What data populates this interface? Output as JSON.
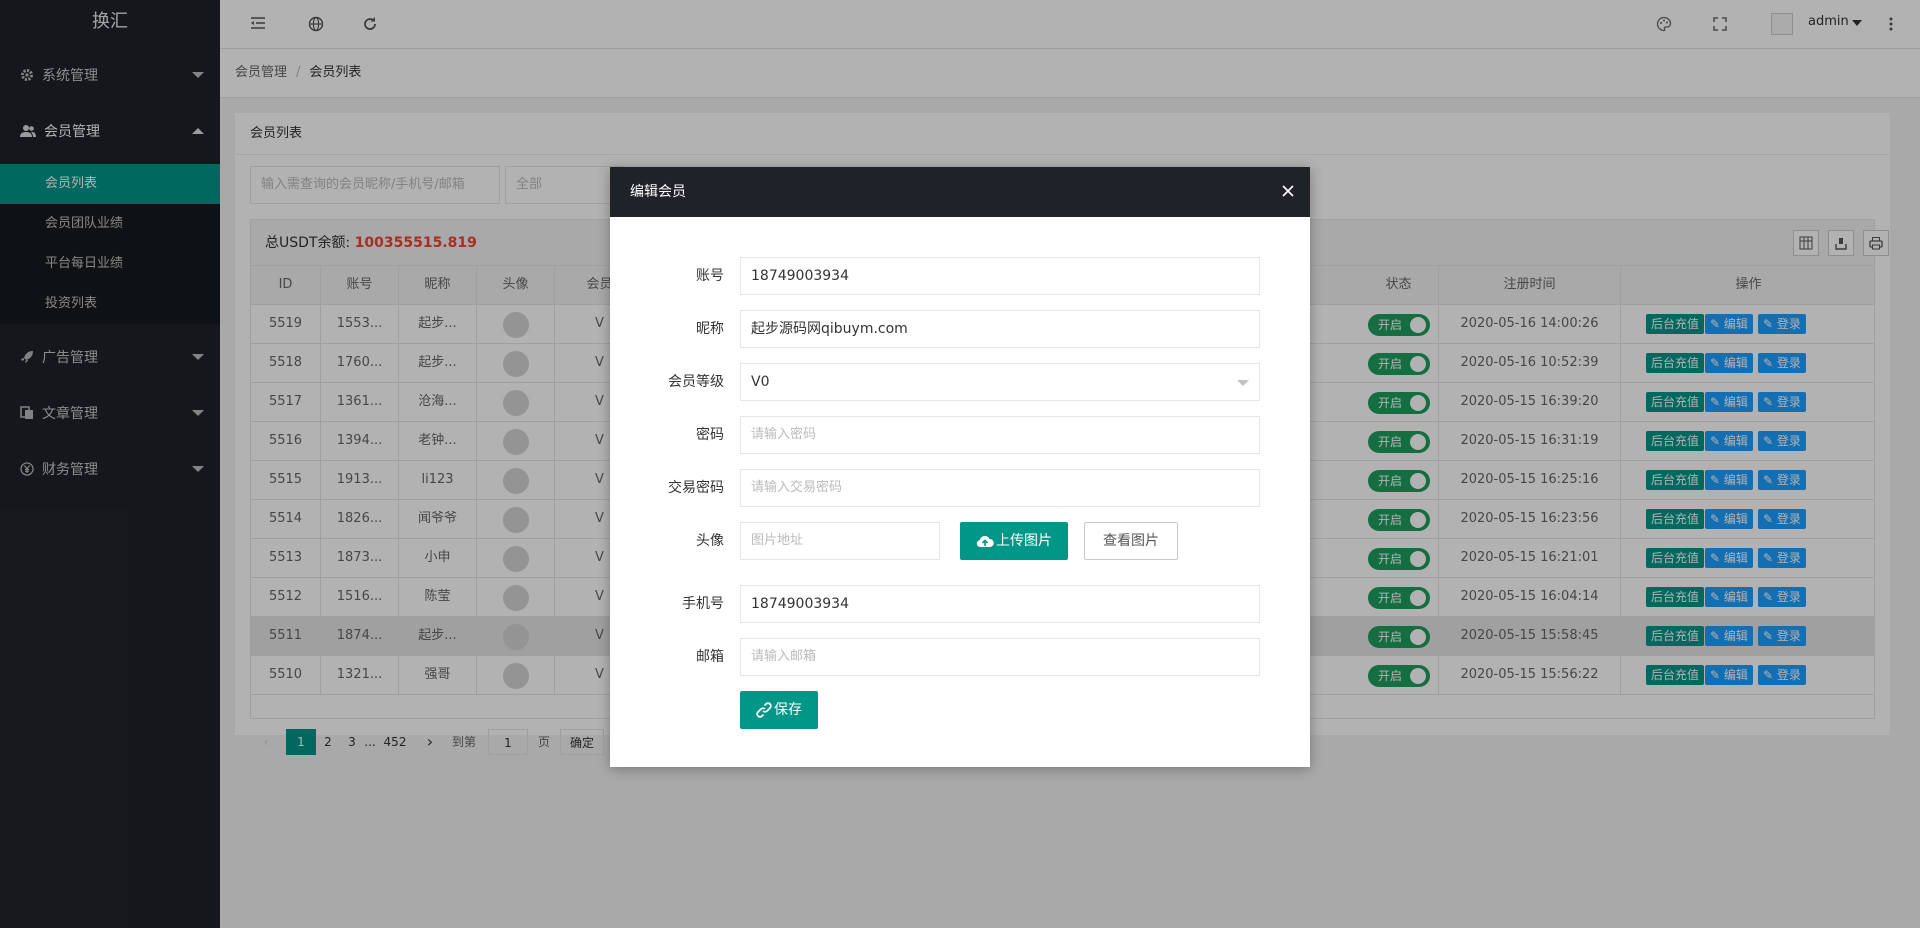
{
  "app": {
    "logo": "换汇",
    "user": "admin"
  },
  "sidebar": {
    "groups": [
      {
        "label": "系统管理",
        "icon": "gear-icon"
      },
      {
        "label": "会员管理",
        "icon": "users-icon",
        "expanded": true,
        "items": [
          "会员列表",
          "会员团队业绩",
          "平台每日业绩",
          "投资列表"
        ]
      },
      {
        "label": "广告管理",
        "icon": "rocket-icon"
      },
      {
        "label": "文章管理",
        "icon": "copy-icon"
      },
      {
        "label": "财务管理",
        "icon": "yen-icon"
      }
    ],
    "active_item": "会员列表"
  },
  "breadcrumb": {
    "parent": "会员管理",
    "separator": "/",
    "current": "会员列表"
  },
  "panel": {
    "title": "会员列表",
    "search_placeholder": "输入需查询的会员昵称/手机号/邮箱",
    "filter_value": "全部",
    "balance_label": "总USDT余额:",
    "balance_value": "100355515.819"
  },
  "table": {
    "columns": [
      "ID",
      "账号",
      "昵称",
      "头像",
      "会员",
      "状态",
      "注册时间",
      "操作"
    ],
    "switch_label": "开启",
    "actions": {
      "recharge": "后台充值",
      "edit": "编辑",
      "login": "登录"
    },
    "rows": [
      {
        "id": "5519",
        "account": "1553...",
        "nick": "起步...",
        "level": "V",
        "time": "2020-05-16 14:00:26"
      },
      {
        "id": "5518",
        "account": "1760...",
        "nick": "起步...",
        "level": "V",
        "time": "2020-05-16 10:52:39"
      },
      {
        "id": "5517",
        "account": "1361...",
        "nick": "沧海...",
        "level": "V",
        "time": "2020-05-15 16:39:20"
      },
      {
        "id": "5516",
        "account": "1394...",
        "nick": "老钟...",
        "level": "V",
        "time": "2020-05-15 16:31:19"
      },
      {
        "id": "5515",
        "account": "1913...",
        "nick": "li123",
        "level": "V",
        "time": "2020-05-15 16:25:16"
      },
      {
        "id": "5514",
        "account": "1826...",
        "nick": "闻爷爷",
        "level": "V",
        "time": "2020-05-15 16:23:56"
      },
      {
        "id": "5513",
        "account": "1873...",
        "nick": "小申",
        "level": "V",
        "time": "2020-05-15 16:21:01"
      },
      {
        "id": "5512",
        "account": "1516...",
        "nick": "陈莹",
        "level": "V",
        "time": "2020-05-15 16:04:14"
      },
      {
        "id": "5511",
        "account": "1874...",
        "nick": "起步...",
        "level": "V",
        "time": "2020-05-15 15:58:45"
      },
      {
        "id": "5510",
        "account": "1321...",
        "nick": "强哥",
        "level": "V",
        "time": "2020-05-15 15:56:22"
      }
    ]
  },
  "pager": {
    "pages": [
      "1",
      "2",
      "3",
      "...",
      "452"
    ],
    "goto_label": "到第",
    "goto_value": "1",
    "page_unit": "页",
    "confirm": "确定"
  },
  "modal": {
    "title": "编辑会员",
    "fields": {
      "account": {
        "label": "账号",
        "value": "18749003934"
      },
      "nickname": {
        "label": "昵称",
        "value": "起步源码网qibuym.com"
      },
      "level": {
        "label": "会员等级",
        "value": "V0"
      },
      "password": {
        "label": "密码",
        "placeholder": "请输入密码"
      },
      "trade_password": {
        "label": "交易密码",
        "placeholder": "请输入交易密码"
      },
      "avatar": {
        "label": "头像",
        "placeholder": "图片地址",
        "upload": "上传图片",
        "view": "查看图片"
      },
      "phone": {
        "label": "手机号",
        "value": "18749003934"
      },
      "email": {
        "label": "邮箱",
        "placeholder": "请输入邮箱"
      }
    },
    "save": "保存"
  },
  "colors": {
    "primary": "#009688",
    "blue": "#1e9fff",
    "sidebar": "#20222a",
    "danger": "#e43333"
  }
}
